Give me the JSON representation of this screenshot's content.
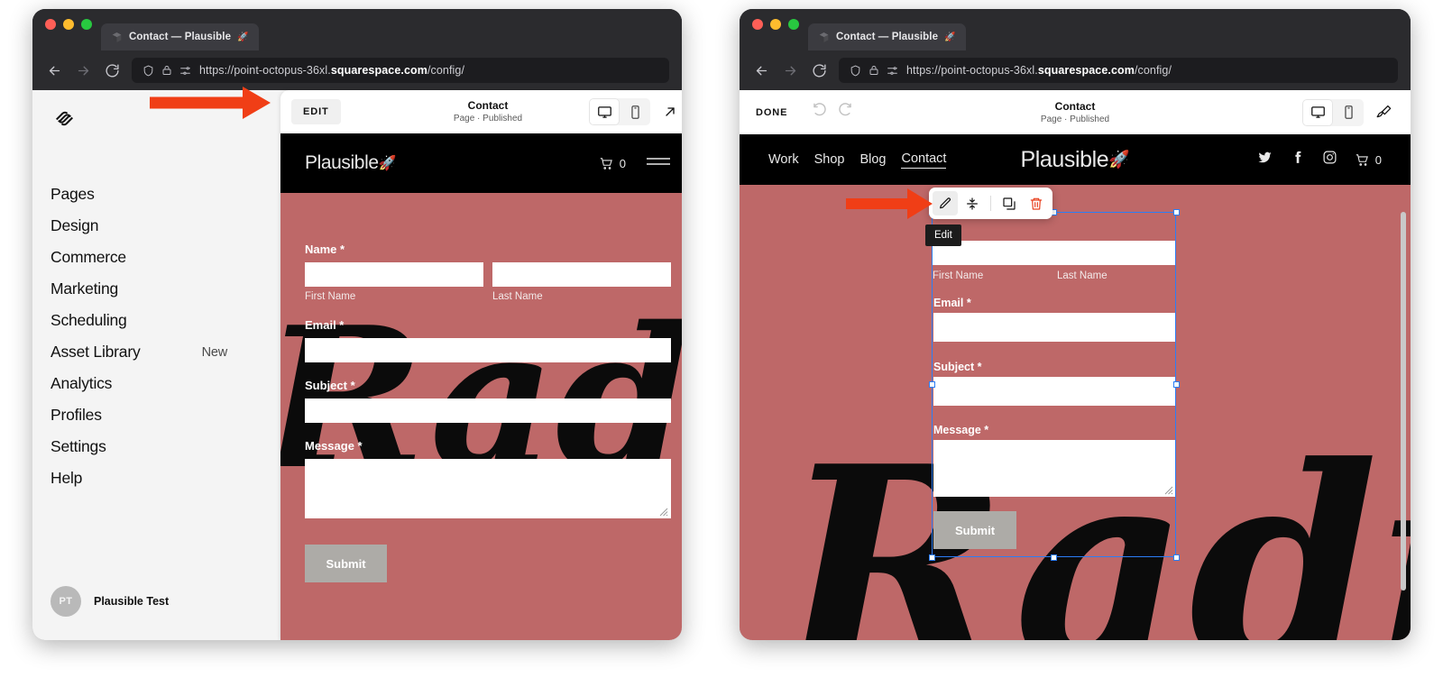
{
  "browser": {
    "tab_title": "Contact — Plausible",
    "tab_emoji": "🚀",
    "url_prefix": "https://point-octopus-36xl.",
    "url_domain": "squarespace.com",
    "url_suffix": "/config/"
  },
  "sidebar": {
    "items": [
      {
        "label": "Pages",
        "badge": ""
      },
      {
        "label": "Design",
        "badge": ""
      },
      {
        "label": "Commerce",
        "badge": ""
      },
      {
        "label": "Marketing",
        "badge": ""
      },
      {
        "label": "Scheduling",
        "badge": ""
      },
      {
        "label": "Asset Library",
        "badge": "New"
      },
      {
        "label": "Analytics",
        "badge": ""
      },
      {
        "label": "Profiles",
        "badge": ""
      },
      {
        "label": "Settings",
        "badge": ""
      },
      {
        "label": "Help",
        "badge": ""
      }
    ],
    "user": {
      "initials": "PT",
      "name": "Plausible Test"
    }
  },
  "preview_toolbar": {
    "edit_label": "EDIT",
    "page_title": "Contact",
    "page_status": "Page · Published"
  },
  "editor_toolbar": {
    "done_label": "DONE",
    "page_title": "Contact",
    "page_status": "Page · Published"
  },
  "site": {
    "brand": "Plausible",
    "brand_emoji": "🚀",
    "cart_count": "0",
    "nav_links": [
      "Work",
      "Shop",
      "Blog",
      "Contact"
    ],
    "active_link": "Contact",
    "watermark": "Radiant"
  },
  "form": {
    "name_label": "Name *",
    "first_name_sub": "First Name",
    "last_name_sub": "Last Name",
    "email_label": "Email *",
    "subject_label": "Subject *",
    "message_label": "Message *",
    "submit_label": "Submit"
  },
  "block_toolbar": {
    "tooltip": "Edit",
    "buttons": [
      "edit-pencil-icon",
      "collapse-vertical-icon",
      "duplicate-icon",
      "delete-trash-icon"
    ]
  },
  "colors": {
    "site_bg": "#be6868",
    "site_nav_bg": "#000000",
    "annotation_arrow": "#f03e16",
    "selection_blue": "#2b7ef5",
    "submit_button": "#adaba7",
    "chrome_bg": "#2b2b2e"
  }
}
